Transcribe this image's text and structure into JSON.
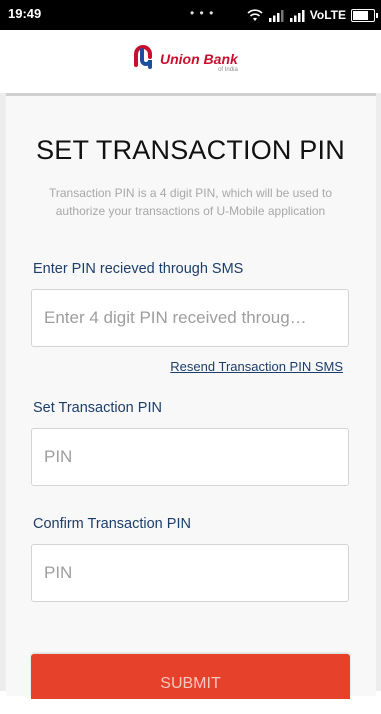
{
  "status_bar": {
    "time": "19:49",
    "network": "VoLTE"
  },
  "header": {
    "brand_name": "Union Bank",
    "brand_sub": "of India",
    "brand_color": "#c8102e"
  },
  "page": {
    "title": "SET TRANSACTION PIN",
    "description": "Transaction PIN is a 4 digit PIN, which will be used to authorize your transactions of U-Mobile application"
  },
  "form": {
    "sms_pin_label": "Enter PIN recieved through SMS",
    "sms_pin_placeholder": "Enter 4 digit PIN received throug…",
    "resend_link": "Resend Transaction PIN SMS",
    "set_pin_label": "Set Transaction PIN",
    "set_pin_placeholder": "PIN",
    "confirm_pin_label": "Confirm Transaction PIN",
    "confirm_pin_placeholder": "PIN",
    "submit_label": "SUBMIT",
    "submit_color": "#e6422b"
  }
}
